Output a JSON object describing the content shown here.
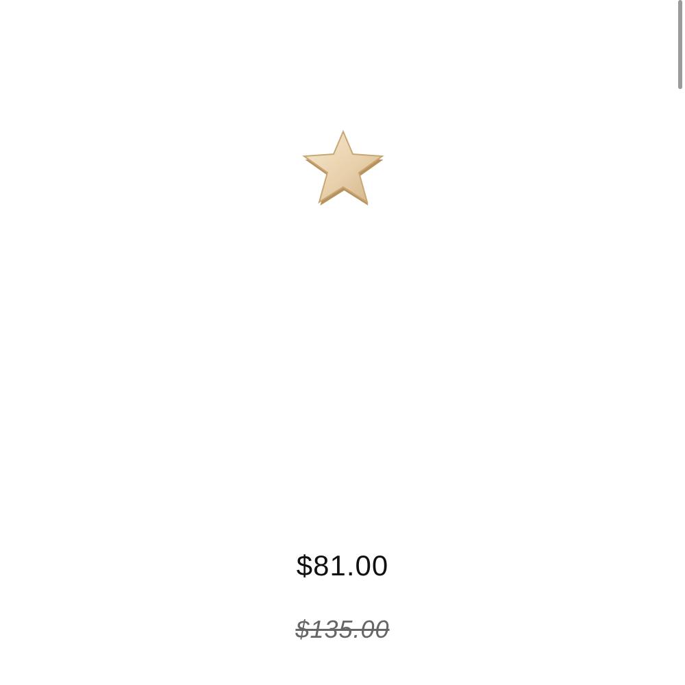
{
  "product": {
    "image_icon": "gold-star-earring-image",
    "colors": {
      "gold_light": "#F2E1C2",
      "gold_mid": "#DCC29A",
      "gold_dark": "#B8925E"
    }
  },
  "pricing": {
    "current_price": "$81.00",
    "original_price": "$135.00"
  },
  "colors": {
    "background": "#FFFFFF",
    "price_text": "#111111",
    "strike_text": "#666666",
    "scrollbar": "#9A9A9A"
  }
}
